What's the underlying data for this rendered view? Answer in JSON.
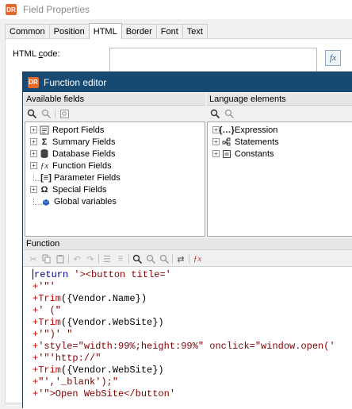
{
  "field_properties": {
    "logo_text": "DR",
    "title": "Field Properties",
    "tabs": [
      "Common",
      "Position",
      "HTML",
      "Border",
      "Font",
      "Text"
    ],
    "active_tab": "HTML",
    "html_code_label_pre": "HTML ",
    "html_code_label_u": "c",
    "html_code_label_post": "ode:",
    "fx_button": "fx"
  },
  "function_editor": {
    "logo_text": "DR",
    "title": "Function editor",
    "available_fields": {
      "header": "Available fields",
      "tree": [
        {
          "label": "Report Fields",
          "expandable": true,
          "icon": "report-fields-icon"
        },
        {
          "label": "Summary Fields",
          "expandable": true,
          "icon": "sigma-icon",
          "glyph": "Σ"
        },
        {
          "label": "Database Fields",
          "expandable": true,
          "icon": "database-icon"
        },
        {
          "label": "Function Fields",
          "expandable": true,
          "icon": "function-icon",
          "glyph": "ƒx"
        },
        {
          "label": "Parameter Fields",
          "expandable": false,
          "icon": "parameter-icon",
          "glyph": "[≡]"
        },
        {
          "label": "Special Fields",
          "expandable": true,
          "icon": "omega-icon",
          "glyph": "Ω"
        },
        {
          "label": "Global variables",
          "expandable": false,
          "icon": "global-variable-icon"
        }
      ]
    },
    "language_elements": {
      "header": "Language elements",
      "tree": [
        {
          "label": "Expression",
          "expandable": true,
          "icon": "expression-icon",
          "glyph": "{…}"
        },
        {
          "label": "Statements",
          "expandable": true,
          "icon": "statements-icon"
        },
        {
          "label": "Constants",
          "expandable": true,
          "icon": "constants-icon"
        }
      ]
    },
    "function_header": "Function",
    "code_lines": [
      [
        {
          "t": "return",
          "c": "kw"
        },
        {
          "t": " '><button title='",
          "c": "str"
        }
      ],
      [
        {
          "t": "+",
          "c": "plus"
        },
        {
          "t": "'\"'",
          "c": "str"
        }
      ],
      [
        {
          "t": "+",
          "c": "plus"
        },
        {
          "t": "Trim",
          "c": "fn"
        },
        {
          "t": "({Vendor.Name})",
          "c": "field"
        }
      ],
      [
        {
          "t": "+",
          "c": "plus"
        },
        {
          "t": "' (\"",
          "c": "str"
        }
      ],
      [
        {
          "t": "+",
          "c": "plus"
        },
        {
          "t": "Trim",
          "c": "fn"
        },
        {
          "t": "({Vendor.WebSite})",
          "c": "field"
        }
      ],
      [
        {
          "t": "+",
          "c": "plus"
        },
        {
          "t": "'\")' \"",
          "c": "str"
        }
      ],
      [
        {
          "t": "+",
          "c": "plus"
        },
        {
          "t": "'style=\"width:99%;height:99%\" onclick=\"window.open('",
          "c": "str"
        }
      ],
      [
        {
          "t": "+",
          "c": "plus"
        },
        {
          "t": "'\"'http://\"",
          "c": "str"
        }
      ],
      [
        {
          "t": "+",
          "c": "plus"
        },
        {
          "t": "Trim",
          "c": "fn"
        },
        {
          "t": "({Vendor.WebSite})",
          "c": "field"
        }
      ],
      [
        {
          "t": "+",
          "c": "plus"
        },
        {
          "t": "\"','_blank');\"",
          "c": "str"
        }
      ],
      [
        {
          "t": "+",
          "c": "plus"
        },
        {
          "t": "'\">Open WebSite</button'",
          "c": "str"
        }
      ]
    ]
  },
  "colors": {
    "title_bar": "#164a72",
    "logo": "#e7672a",
    "code_plus": "#c00000",
    "code_function": "#c00000",
    "code_string": "#800000",
    "code_keyword": "#000080"
  }
}
